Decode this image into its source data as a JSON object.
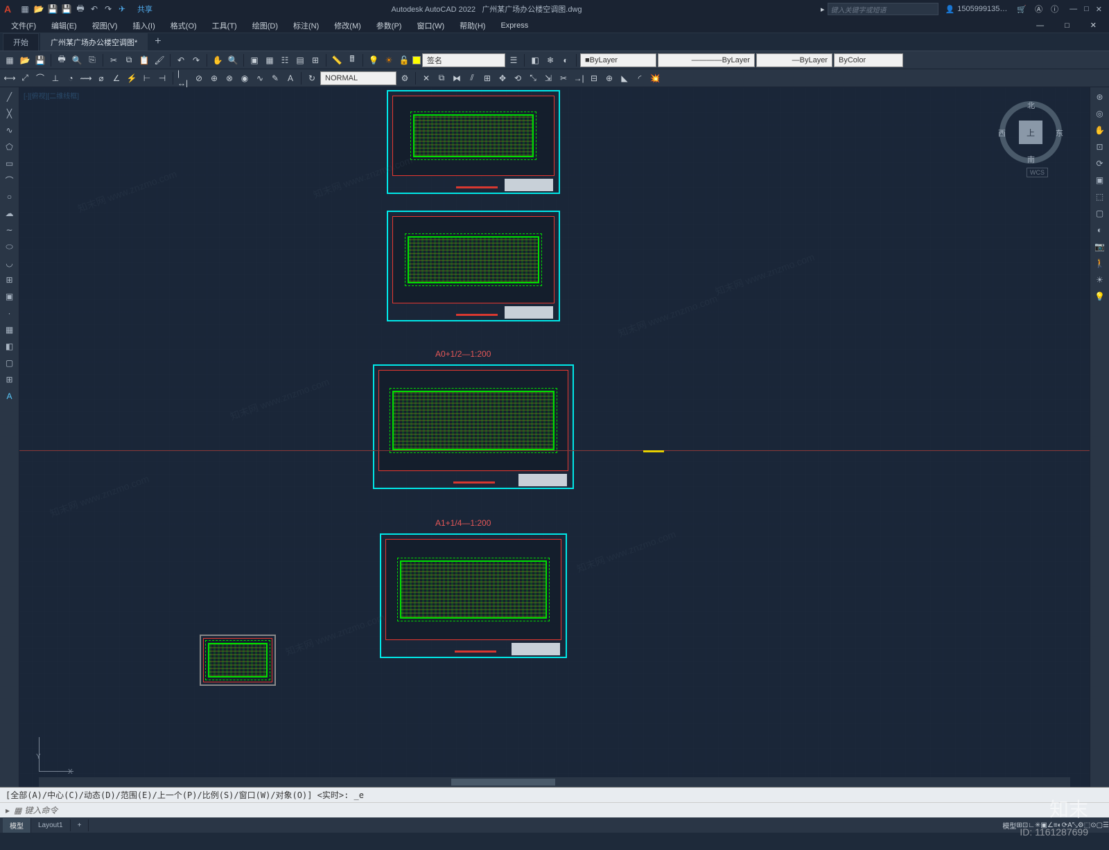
{
  "app": {
    "title": "Autodesk AutoCAD 2022",
    "filename": "广州某广场办公楼空调图.dwg",
    "logo": "A",
    "share": "共享",
    "search_placeholder": "键入关键字或短语",
    "user": "1505999135…",
    "min": "—",
    "max": "□",
    "close": "✕"
  },
  "menus": [
    "文件(F)",
    "编辑(E)",
    "视图(V)",
    "插入(I)",
    "格式(O)",
    "工具(T)",
    "绘图(D)",
    "标注(N)",
    "修改(M)",
    "参数(P)",
    "窗口(W)",
    "帮助(H)",
    "Express"
  ],
  "filetabs": {
    "start": "开始",
    "active": "广州某广场办公楼空调图*",
    "plus": "+"
  },
  "toolbar2": {
    "layer_label": "签名",
    "bylayer1": "ByLayer",
    "bylayer2": "ByLayer",
    "bylayer3": "ByLayer",
    "bycolor": "ByColor",
    "normal": "NORMAL"
  },
  "canvas": {
    "vp_label": "[-][俯视][二维线框]",
    "sheet_label1": "A0+1/2—1:200",
    "sheet_label2": "A1+1/4—1:200",
    "cube": {
      "top": "上",
      "n": "北",
      "s": "南",
      "e": "东",
      "w": "西",
      "wcs": "WCS"
    },
    "ucs": {
      "x": "X",
      "y": "Y"
    }
  },
  "cmd": {
    "hist": "[全部(A)/中心(C)/动态(D)/范围(E)/上一个(P)/比例(S)/窗口(W)/对象(O)] <实时>: _e",
    "prompt_icon": "▸",
    "prompt": "键入命令"
  },
  "btabs": {
    "model": "模型",
    "layout": "Layout1"
  },
  "status": {
    "model": "模型"
  },
  "watermark": {
    "text": "知末网 www.znzmo.com",
    "logo": "知末",
    "id": "ID: 1161287699"
  }
}
